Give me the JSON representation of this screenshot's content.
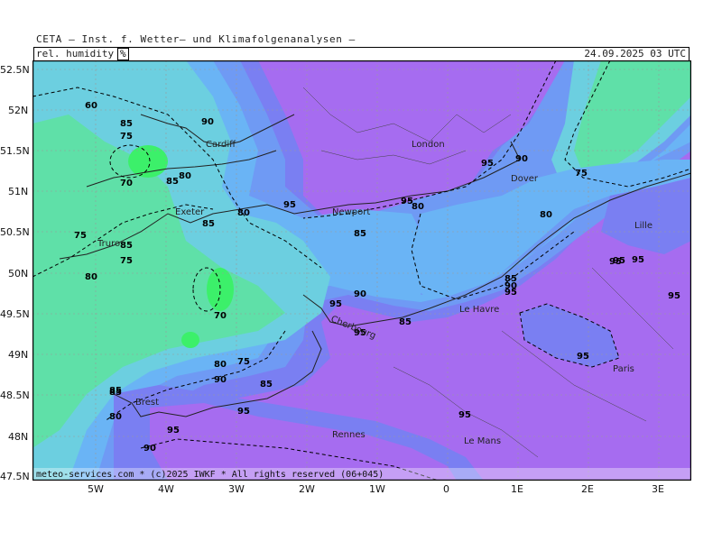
{
  "header": {
    "title": "CETA — Inst. f. Wetter— und Klimafolgenanalysen —",
    "variable": "rel. humidity",
    "unit": "%",
    "datetime": "24.09.2025 03 UTC"
  },
  "footer": {
    "copyright": "meteo-services.com * (c)2025 IWKF * All rights reserved (06+045)"
  },
  "axes": {
    "lat_ticks": [
      "52.5N",
      "52N",
      "51.5N",
      "51N",
      "50.5N",
      "50N",
      "49.5N",
      "49N",
      "48.5N",
      "48N",
      "47.5N"
    ],
    "lon_ticks": [
      "5W",
      "4W",
      "3W",
      "2W",
      "1W",
      "0",
      "1E",
      "2E",
      "3E"
    ]
  },
  "cities": [
    {
      "name": "Cardiff",
      "label": "Cardiff"
    },
    {
      "name": "London",
      "label": "London"
    },
    {
      "name": "Dover",
      "label": "Dover"
    },
    {
      "name": "Exeter",
      "label": "Exeter"
    },
    {
      "name": "Newport",
      "label": "Newport"
    },
    {
      "name": "Truro",
      "label": "Truro"
    },
    {
      "name": "Lille",
      "label": "Lille"
    },
    {
      "name": "Cherbourg",
      "label": "Cherbourg"
    },
    {
      "name": "Le Havre",
      "label": "Le Havre"
    },
    {
      "name": "Paris",
      "label": "Paris"
    },
    {
      "name": "Brest",
      "label": "Brest"
    },
    {
      "name": "Rennes",
      "label": "Rennes"
    },
    {
      "name": "Le Mans",
      "label": "Le Mans"
    }
  ],
  "contour_labels": [
    "60",
    "85",
    "75",
    "90",
    "80",
    "70",
    "85",
    "95",
    "80",
    "85",
    "75",
    "95",
    "85",
    "80",
    "90",
    "95",
    "95",
    "90",
    "75",
    "80",
    "95",
    "85",
    "80",
    "75",
    "70",
    "95",
    "85",
    "95",
    "85",
    "90",
    "85",
    "95",
    "95",
    "80",
    "90",
    "75",
    "85",
    "95",
    "90",
    "95",
    "95",
    "95",
    "85",
    "80",
    "95"
  ],
  "colors": {
    "rh_95_plus": "#a66cf0",
    "rh_90_95": "#7a7ff2",
    "rh_85_90": "#6f9af4",
    "rh_80_85": "#6ab4f5",
    "rh_75_80": "#6ccfe0",
    "rh_70_75": "#5fe0a8",
    "rh_below_70": "#3cf06a"
  }
}
